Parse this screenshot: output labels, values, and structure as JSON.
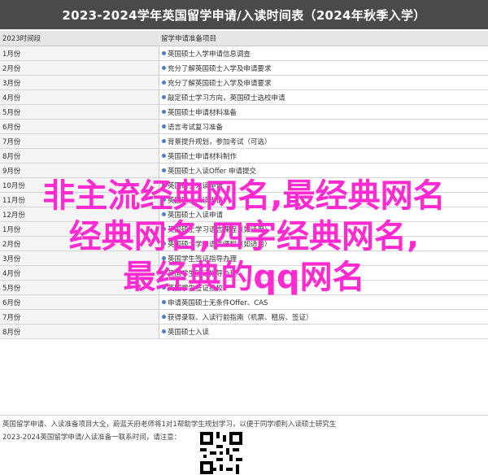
{
  "header": {
    "title": "2023-2024学年英国留学申请/入读时间表（2024年秋季入学）"
  },
  "table": {
    "col_time": "2023时间段",
    "col_plan": "留学申请准备项目",
    "rows": [
      {
        "time": "1月份",
        "plan": "英国硕士入学申请信息调查"
      },
      {
        "time": "2月份",
        "plan": "充分了解英国硕士入学及申请要求"
      },
      {
        "time": "3月份",
        "plan": "充分了解英国硕士入学及申请要求"
      },
      {
        "time": "4月份",
        "plan": "敲定硕士学习方向，英国硕士选校申请"
      },
      {
        "time": "5月份",
        "plan": "英国硕士申请材料准备"
      },
      {
        "time": "6月份",
        "plan": "语言考试复习准备"
      },
      {
        "time": "7月份",
        "plan": "背景提升规划，参加考试（可选）"
      },
      {
        "time": "8月份",
        "plan": "英国硕士申请材料制作"
      },
      {
        "time": "9月份",
        "plan": "英国硕士入读Offer 申请提交"
      },
      {
        "time": "10月份",
        "plan": "英国硕士入读申请"
      },
      {
        "time": "11月份",
        "plan": "英国硕士入读申请"
      },
      {
        "time": "12月份",
        "plan": "英国硕士入读申请"
      },
      {
        "time": "1月份",
        "plan": "英国硕士学习语言课程（如适用）"
      },
      {
        "time": "2月份",
        "plan": "英国硕士学习语言课程（如适用）"
      },
      {
        "time": "3月份",
        "plan": "英国学生签证指导办理"
      },
      {
        "time": "4月份",
        "plan": "英国学生签证指导办理"
      },
      {
        "time": "5月份",
        "plan": "英国学生签证抵校"
      },
      {
        "time": "6月份",
        "plan": "申请英国硕士无条件Offer、CAS"
      },
      {
        "time": "7月份",
        "plan": "获得录取、入读行前指南（机票、租房、签证）"
      },
      {
        "time": "8月份",
        "plan": "英国硕士入读"
      }
    ]
  },
  "footer": {
    "line1": "英国留学申请、入读准备项目大全，蔚蓝天府老师将1对1帮助学生规划学习，以便于同学顺利入读硕士研究生",
    "line2": "2023-2024英国留学申请/入读准备一联系时间，请注意："
  },
  "overlay": {
    "line1": "非主流经典网名,最经典网名",
    "line2": "经典网名,四字经典网名,",
    "line3": "最经典的qq网名"
  },
  "colors": {
    "header_bg": "#4a4a4a",
    "overlay_text": "#ff2bd0",
    "bullet": "#4a7ec8"
  }
}
